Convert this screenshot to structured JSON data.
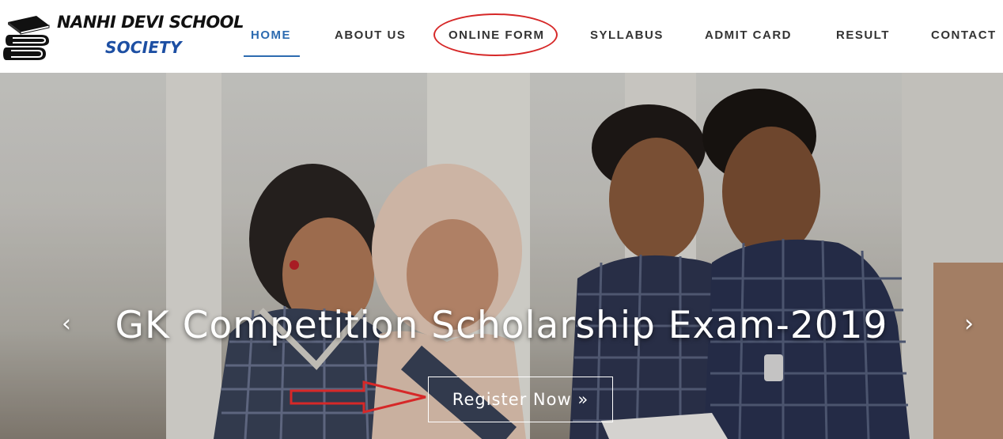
{
  "brand": {
    "line1": "NANHI DEVI SCHOOL",
    "line2": "SOCIETY",
    "icon": "books-stack-icon",
    "accent_color": "#1d4fa3"
  },
  "nav": {
    "items": [
      {
        "label": "HOME",
        "active": true
      },
      {
        "label": "ABOUT US",
        "active": false
      },
      {
        "label": "ONLINE FORM",
        "active": false
      },
      {
        "label": "SYLLABUS",
        "active": false
      },
      {
        "label": "ADMIT CARD",
        "active": false
      },
      {
        "label": "RESULT",
        "active": false
      },
      {
        "label": "CONTACT",
        "active": false
      }
    ],
    "active_color": "#2d6bb0",
    "highlighted_item": "ONLINE FORM",
    "highlight_color": "#d62828"
  },
  "hero": {
    "title": "GK Competition Scholarship Exam-2019",
    "prev_arrow": "‹",
    "next_arrow": "›",
    "cta_label": "Register Now »",
    "annotation_arrow_color": "#d62828"
  }
}
